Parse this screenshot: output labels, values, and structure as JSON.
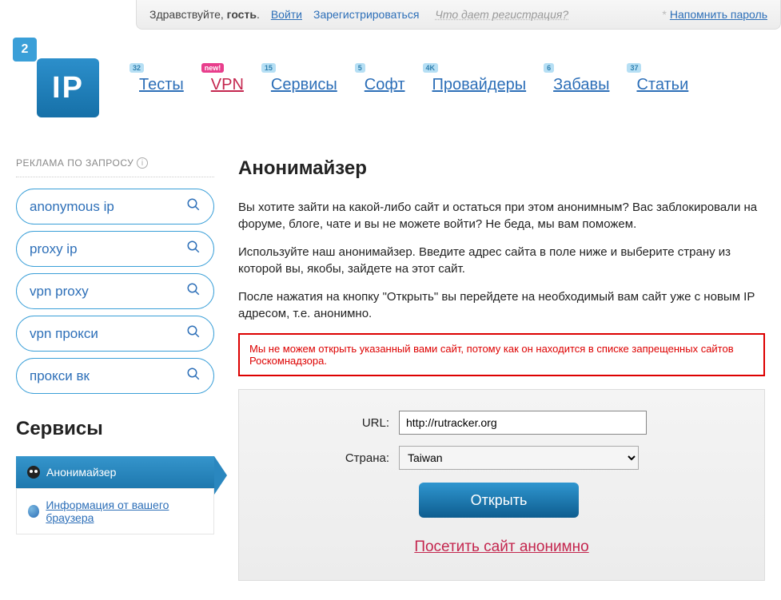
{
  "topbar": {
    "greeting_prefix": "Здравствуйте, ",
    "greeting_bold": "гость",
    "greeting_suffix": ".",
    "login": "Войти",
    "register": "Зарегистрироваться",
    "what_reg": "Что дает регистрация?",
    "star": "*",
    "remember": "Напомнить пароль"
  },
  "logo": {
    "small": "2",
    "big": "IP"
  },
  "nav": [
    {
      "label": "Тесты",
      "badge": "32"
    },
    {
      "label": "VPN",
      "badge": "new!",
      "new": true
    },
    {
      "label": "Сервисы",
      "badge": "15"
    },
    {
      "label": "Софт",
      "badge": "5"
    },
    {
      "label": "Провайдеры",
      "badge": "4K"
    },
    {
      "label": "Забавы",
      "badge": "6"
    },
    {
      "label": "Статьи",
      "badge": "37"
    }
  ],
  "sidebar": {
    "ad_heading": "РЕКЛАМА ПО ЗАПРОСУ",
    "ads": [
      "anonymous ip",
      "proxy ip",
      "vpn proxy",
      "vpn прокси",
      "прокси вк"
    ],
    "services_title": "Сервисы",
    "services": [
      {
        "label": "Анонимайзер",
        "active": true,
        "icon": "mask"
      },
      {
        "label": "Информация от вашего браузера",
        "active": false,
        "icon": "globe"
      }
    ]
  },
  "main": {
    "title": "Анонимайзер",
    "p1": "Вы хотите зайти на какой-либо сайт и остаться при этом анонимным? Вас заблокировали на форуме, блоге, чате и вы не можете войти? Не беда, мы вам поможем.",
    "p2": "Используйте наш анонимайзер. Введите адрес сайта в поле ниже и выберите страну из которой вы, якобы, зайдете на этот сайт.",
    "p3": "После нажатия на кнопку \"Открыть\" вы перейдете на необходимый вам сайт уже с новым IP адресом, т.е. анонимно.",
    "error": "Мы не можем открыть указанный вами сайт, потому как он находится в списке запрещенных сайтов Роскомнадзора.",
    "form": {
      "url_label": "URL:",
      "url_value": "http://rutracker.org",
      "country_label": "Страна:",
      "country_value": "Taiwan",
      "submit": "Открыть"
    },
    "visit_link": "Посетить сайт анонимно"
  }
}
